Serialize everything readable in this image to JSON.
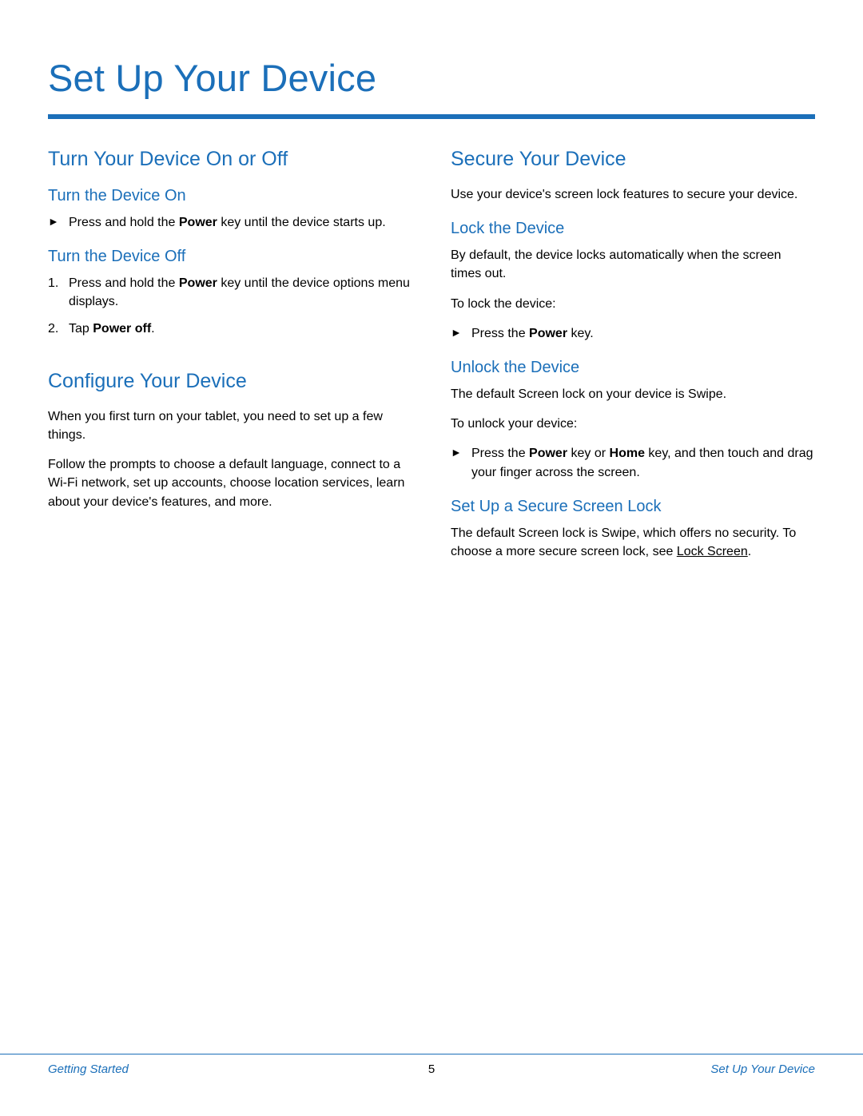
{
  "page_title": "Set Up Your Device",
  "left": {
    "section1_title": "Turn Your Device On or Off",
    "sub1_title": "Turn the Device On",
    "sub1_step_pre": "Press and hold the ",
    "sub1_step_bold": "Power",
    "sub1_step_post": " key until the device starts up.",
    "sub2_title": "Turn the Device Off",
    "sub2_step1_pre": "Press and hold the ",
    "sub2_step1_bold": "Power",
    "sub2_step1_post": " key until the device options menu displays.",
    "sub2_step2_pre": "Tap ",
    "sub2_step2_bold": "Power off",
    "sub2_step2_post": ".",
    "section2_title": "Configure Your Device",
    "config_p1": "When you first turn on your tablet, you need to set up a few things.",
    "config_p2": "Follow the prompts to choose a default language, connect to a Wi-Fi network, set up accounts, choose location services, learn about your device's features, and more."
  },
  "right": {
    "section1_title": "Secure Your Device",
    "intro": "Use your device's screen lock features to secure your device.",
    "sub1_title": "Lock the Device",
    "lock_p1": "By default, the device locks automatically when the screen times out.",
    "lock_p2": "To lock the device:",
    "lock_step_pre": "Press the ",
    "lock_step_bold": "Power",
    "lock_step_post": " key.",
    "sub2_title": "Unlock the Device",
    "unlock_p1": "The default Screen lock on your device is Swipe.",
    "unlock_p2": "To unlock your device:",
    "unlock_step_pre": "Press the ",
    "unlock_step_bold1": "Power",
    "unlock_step_mid": " key or ",
    "unlock_step_bold2": "Home",
    "unlock_step_post": " key, and then touch and drag your finger across the screen.",
    "sub3_title": "Set Up a Secure Screen Lock",
    "secure_pre": "The default Screen lock is Swipe, which offers no security. To choose a more secure screen lock, see ",
    "secure_link": "Lock Screen",
    "secure_post": "."
  },
  "footer": {
    "left": "Getting Started",
    "center": "5",
    "right": "Set Up Your Device"
  },
  "markers": {
    "arrow": "►",
    "n1": "1.",
    "n2": "2."
  }
}
